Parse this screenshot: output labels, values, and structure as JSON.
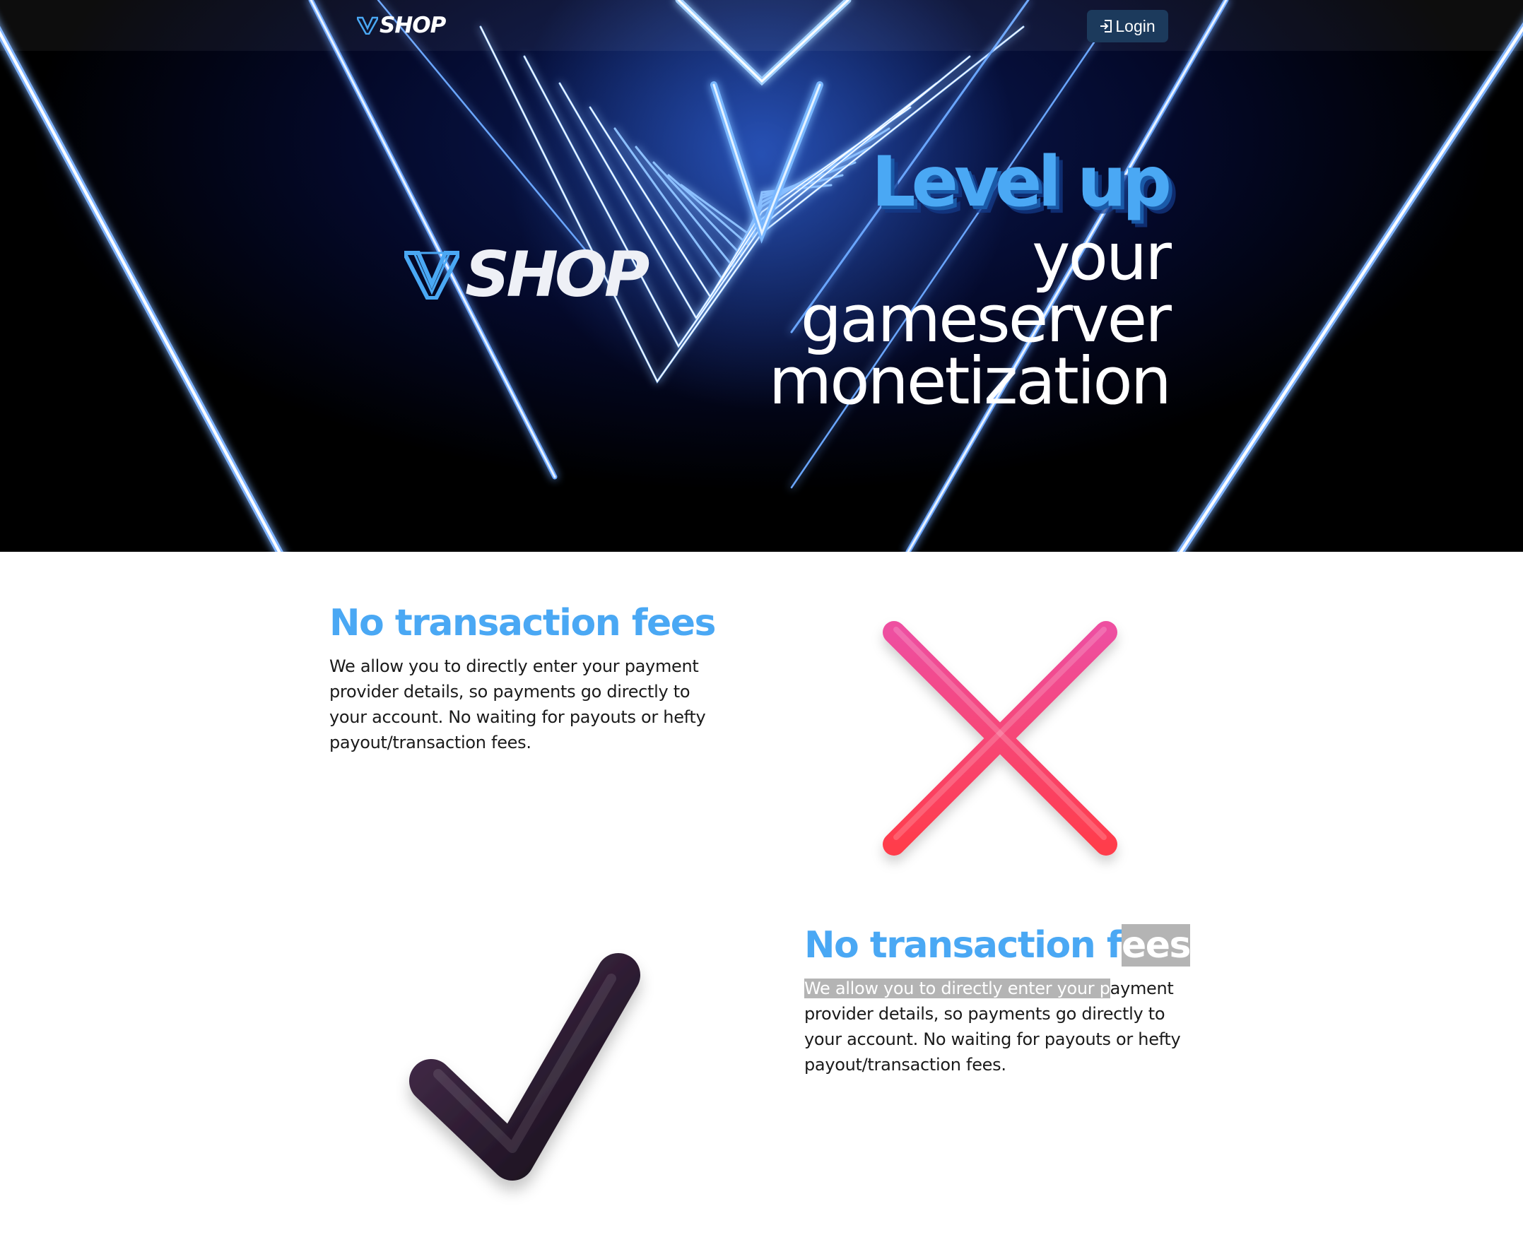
{
  "navbar": {
    "brand": "SHOP",
    "login_label": "Login"
  },
  "hero": {
    "brand": "SHOP",
    "headline_accent": "Level up",
    "headline_lines": [
      "your",
      "gameserver",
      "monetization"
    ]
  },
  "features": [
    {
      "title": "No transaction fees",
      "description": "We allow you to directly enter your payment provider details, so payments go directly to your account. No waiting for payouts or hefty payout/transaction fees.",
      "icon": "cross-icon"
    },
    {
      "title_plain": "No transaction f",
      "title_selected": "ees",
      "desc_selected": "We allow you to directly enter your p",
      "desc_rest": "ayment provider details, so payments go directly to your account. No waiting for payouts or hefty payout/transaction fees.",
      "icon": "checkmark-icon"
    }
  ],
  "colors": {
    "accent": "#4aa8f4",
    "hero_bg": "#000000",
    "login_bg": "#1c3a5c",
    "cross": "#ff3d6e",
    "check": "#3a2438"
  }
}
